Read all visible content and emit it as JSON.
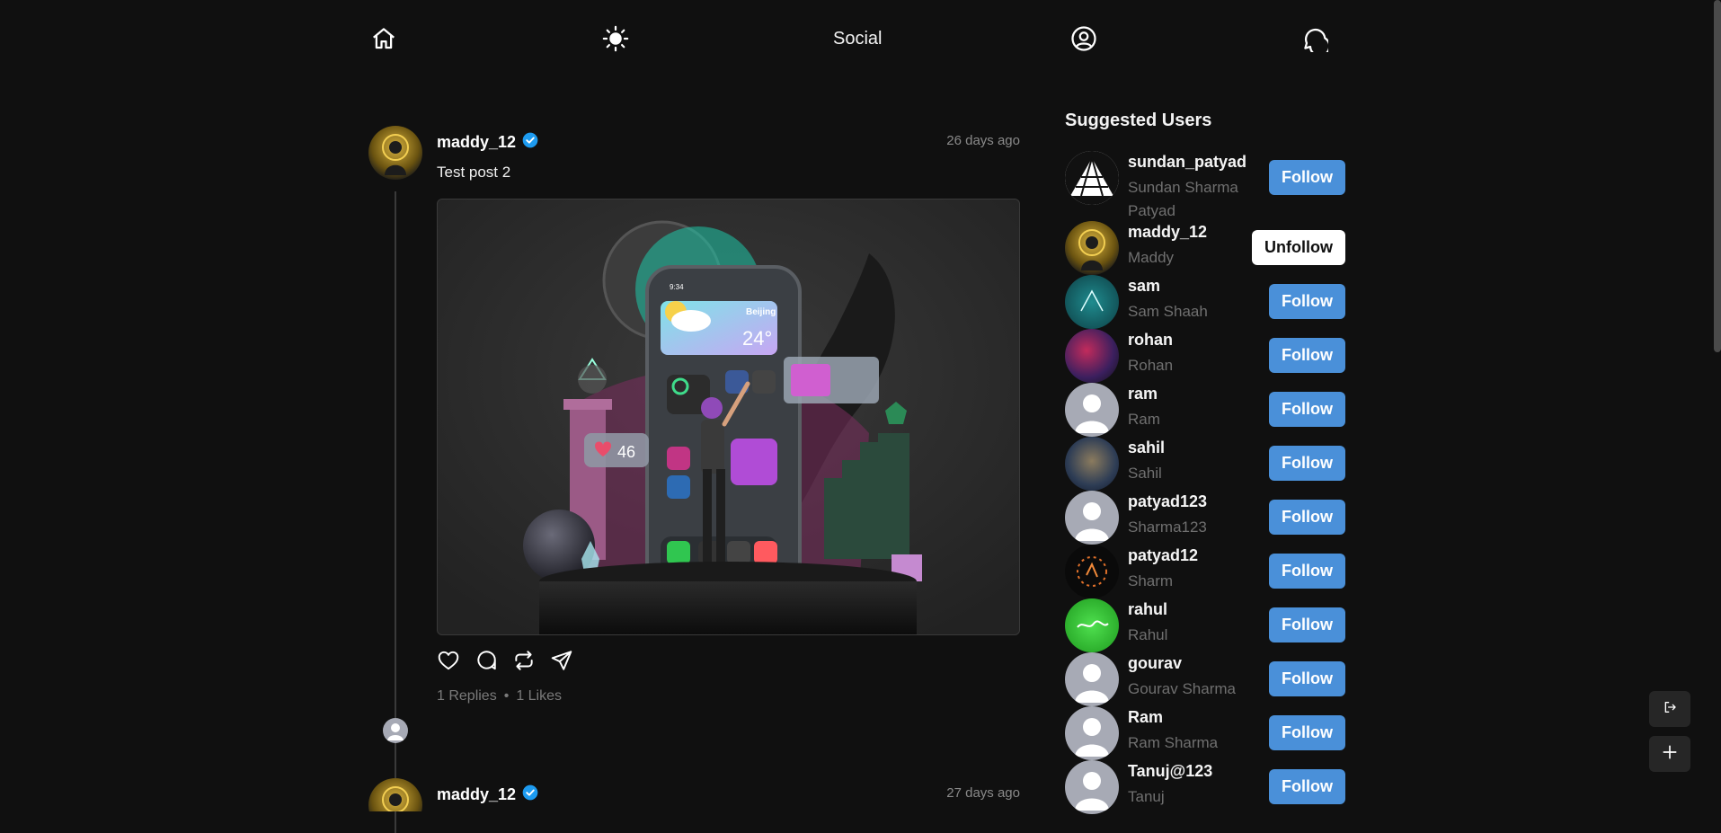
{
  "nav": {
    "title": "Social"
  },
  "posts": [
    {
      "username": "maddy_12",
      "time": "26 days ago",
      "text": "Test post 2",
      "replies": "1 Replies",
      "sep": "•",
      "likes": "1 Likes",
      "phone_city": "Beijing",
      "phone_temp": "24°",
      "phone_time": "9:34",
      "likes_badge": "46"
    },
    {
      "username": "maddy_12",
      "time": "27 days ago"
    }
  ],
  "sidebar": {
    "title": "Suggested Users",
    "users": [
      {
        "username": "sundan_patyad",
        "name": "Sundan Sharma Patyad",
        "action": "Follow"
      },
      {
        "username": "maddy_12",
        "name": "Maddy",
        "action": "Unfollow"
      },
      {
        "username": "sam",
        "name": "Sam Shaah",
        "action": "Follow"
      },
      {
        "username": "rohan",
        "name": "Rohan",
        "action": "Follow"
      },
      {
        "username": "ram",
        "name": "Ram",
        "action": "Follow"
      },
      {
        "username": "sahil",
        "name": "Sahil",
        "action": "Follow"
      },
      {
        "username": "patyad123",
        "name": "Sharma123",
        "action": "Follow"
      },
      {
        "username": "patyad12",
        "name": "Sharm",
        "action": "Follow"
      },
      {
        "username": "rahul",
        "name": "Rahul",
        "action": "Follow"
      },
      {
        "username": "gourav",
        "name": "Gourav Sharma",
        "action": "Follow"
      },
      {
        "username": "Ram",
        "name": "Ram Sharma",
        "action": "Follow"
      },
      {
        "username": "Tanuj@123",
        "name": "Tanuj",
        "action": "Follow"
      }
    ]
  },
  "colors": {
    "background": "#101010",
    "follow": "#4a90d9",
    "verified": "#1d9bf0"
  }
}
